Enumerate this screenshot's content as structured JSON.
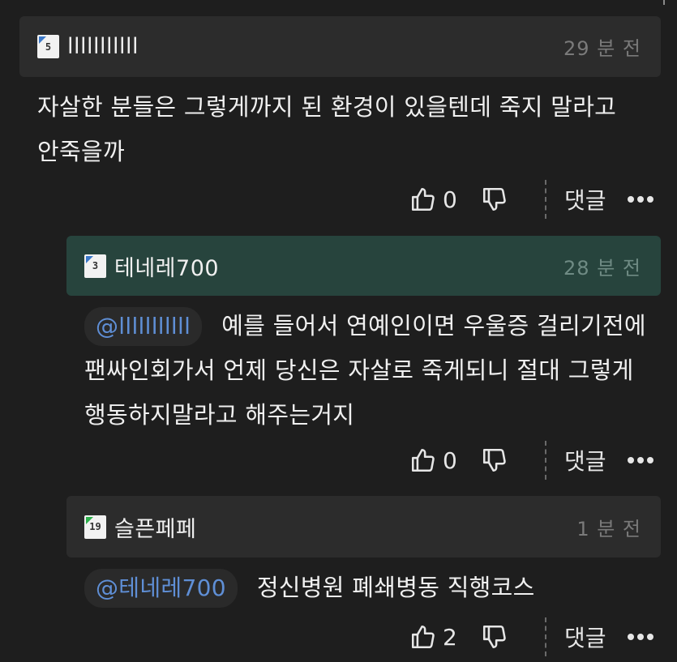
{
  "comments": [
    {
      "username": "lllllllllll",
      "level": "5",
      "time": "29 분 전",
      "mention": "",
      "text": "자살한 분들은 그렇게까지 된 환경이 있을텐데 죽지 말라고 안죽을까",
      "likes": "0",
      "reply_label": "댓글"
    },
    {
      "username": "테네레700",
      "level": "3",
      "time": "28 분 전",
      "mention": "@lllllllllll",
      "text": "예를 들어서 연예인이면 우울증 걸리기전에 팬싸인회가서 언제 당신은 자살로 죽게되니 절대 그렇게 행동하지말라고 해주는거지",
      "likes": "0",
      "reply_label": "댓글"
    },
    {
      "username": "슬픈페페",
      "level": "19",
      "time": "1 분 전",
      "mention": "@테네레700",
      "text": "정신병원 폐쇄병동 직행코스",
      "likes": "2",
      "reply_label": "댓글"
    }
  ],
  "colors": {
    "background": "#1e1e1e",
    "highlight_header": "#27443d",
    "mention": "#5f8fd6"
  }
}
